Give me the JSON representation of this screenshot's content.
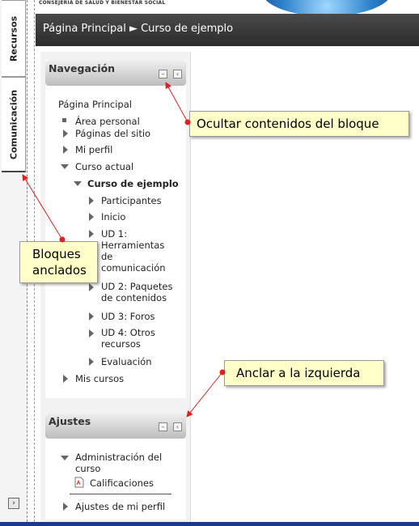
{
  "dock": {
    "tabs": [
      "Recursos",
      "Comunicación"
    ]
  },
  "header": {
    "org_text": "CONSEJERÍA DE SALUD Y BIENESTAR SOCIAL",
    "breadcrumb": [
      "Página Principal",
      "Curso de ejemplo"
    ],
    "breadcrumb_sep": "►"
  },
  "nav_block": {
    "title": "Navegación",
    "items": {
      "home": "Página Principal",
      "personal": "Área personal",
      "site_pages": "Páginas del sitio",
      "profile": "Mi perfil",
      "current_course": "Curso actual",
      "course": "Curso de ejemplo",
      "participants": "Participantes",
      "start": "Inicio",
      "ud1": "UD 1: Herramientas de comunicación",
      "ud2": "UD 2: Paquetes de contenidos",
      "ud3": "UD 3: Foros",
      "ud4": "UD 4: Otros recursos",
      "evaluation": "Evaluación",
      "my_courses": "Mis cursos"
    }
  },
  "settings_block": {
    "title": "Ajustes",
    "items": {
      "course_admin": "Administración del curso",
      "grades": "Calificaciones",
      "profile_settings": "Ajustes de mi perfil"
    }
  },
  "callouts": {
    "hide": "Ocultar contenidos del bloque",
    "docked": "Bloques anclados",
    "dock_left": "Anclar a la izquierda"
  },
  "colors": {
    "callout_bg": "#ffffc8",
    "arrow": "#e02020",
    "breadcrumb_bg": "#3a3a3a"
  }
}
